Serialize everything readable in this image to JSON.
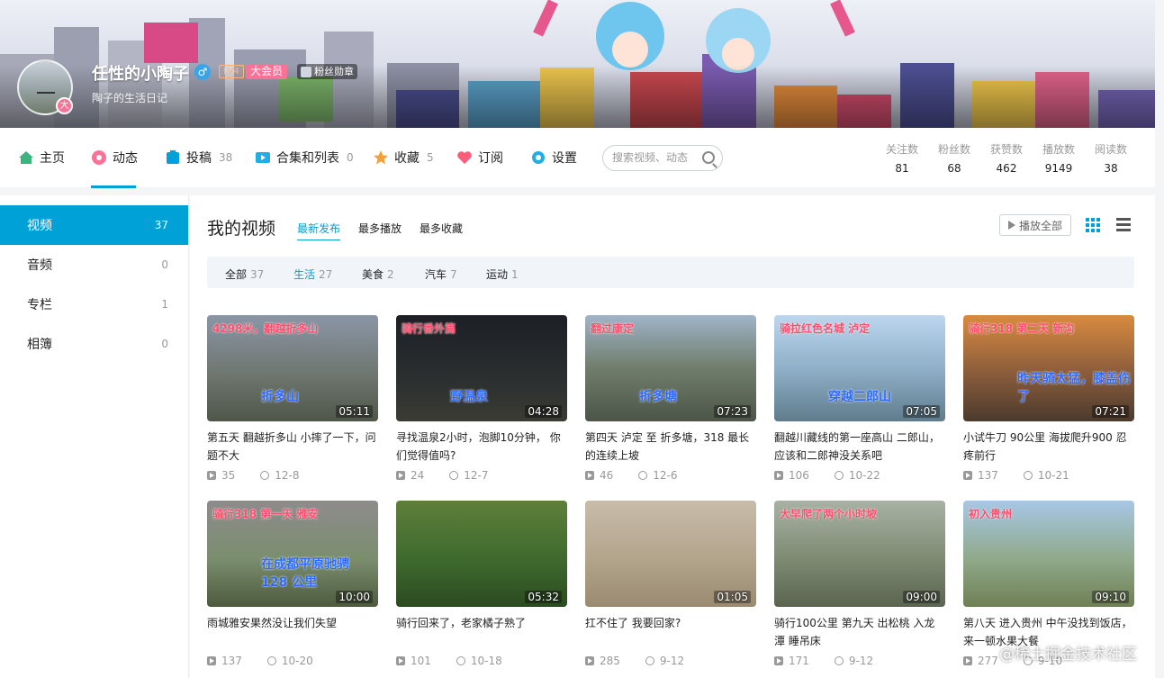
{
  "profile": {
    "name": "任性的小陶子",
    "gender_icon": "♂",
    "level": "LV4",
    "vip_label": "大会员",
    "medal_label": "粉丝勋章",
    "signature": "陶子的生活日记",
    "avatar_badge": "大"
  },
  "nav": {
    "items": [
      {
        "label": "主页",
        "count": "",
        "icon": "home-icon",
        "color": "#3fb37f"
      },
      {
        "label": "动态",
        "count": "",
        "icon": "dynamic-icon",
        "color": "#fb7299"
      },
      {
        "label": "投稿",
        "count": "38",
        "icon": "upload-icon",
        "color": "#00a1d6"
      },
      {
        "label": "合集和列表",
        "count": "0",
        "icon": "collection-icon",
        "color": "#23ade5"
      },
      {
        "label": "收藏",
        "count": "5",
        "icon": "star-icon",
        "color": "#f3a034"
      },
      {
        "label": "订阅",
        "count": "",
        "icon": "heart-icon",
        "color": "#ff5c7c"
      },
      {
        "label": "设置",
        "count": "",
        "icon": "gear-icon",
        "color": "#23ade5"
      }
    ],
    "search_placeholder": "搜索视频、动态",
    "stats": [
      {
        "label": "关注数",
        "value": "81"
      },
      {
        "label": "粉丝数",
        "value": "68"
      },
      {
        "label": "获赞数",
        "value": "462"
      },
      {
        "label": "播放数",
        "value": "9149"
      },
      {
        "label": "阅读数",
        "value": "38"
      }
    ]
  },
  "sidebar": {
    "items": [
      {
        "label": "视频",
        "count": "37"
      },
      {
        "label": "音频",
        "count": "0"
      },
      {
        "label": "专栏",
        "count": "1"
      },
      {
        "label": "相簿",
        "count": "0"
      }
    ]
  },
  "main": {
    "title": "我的视频",
    "sorts": [
      "最新发布",
      "最多播放",
      "最多收藏"
    ],
    "play_all": "播放全部",
    "filters": [
      {
        "label": "全部",
        "count": "37"
      },
      {
        "label": "生活",
        "count": "27"
      },
      {
        "label": "美食",
        "count": "2"
      },
      {
        "label": "汽车",
        "count": "7"
      },
      {
        "label": "运动",
        "count": "1"
      }
    ]
  },
  "videos": [
    {
      "title": "第五天 翻越折多山 小摔了一下，问题不大",
      "duration": "05:11",
      "plays": "35",
      "date": "12-8",
      "cap": "4298米，翻越折多山",
      "cap2": "折多山",
      "bg": "linear-gradient(180deg,#8a96a6 0%,#6f7770 55%,#4f5649 100%)"
    },
    {
      "title": "寻找温泉2小时，泡脚10分钟， 你们觉得值吗?",
      "duration": "04:28",
      "plays": "24",
      "date": "12-7",
      "cap": "骑行番外篇",
      "cap2": "野温泉",
      "bg": "linear-gradient(180deg,#1c1f24 0%,#2b2f30 60%,#3a3b33 100%)"
    },
    {
      "title": "第四天 泸定 至 折多塘，318 最长的连续上坡",
      "duration": "07:23",
      "plays": "46",
      "date": "12-6",
      "cap": "翻过康定",
      "cap2": "折多塘",
      "bg": "linear-gradient(180deg,#9fb4c8 0%,#707d6c 50%,#4c5548 100%)"
    },
    {
      "title": "翻越川藏线的第一座高山 二郎山，应该和二郎神没关系吧",
      "duration": "07:05",
      "plays": "106",
      "date": "10-22",
      "cap": "骑拉红色名城 泸定",
      "cap2": "穿越二郎山",
      "bg": "linear-gradient(180deg,#bcd6ee 0%,#8fb0c8 50%,#607c8c 100%)"
    },
    {
      "title": "小试牛刀 90公里 海拔爬升900 忍疼前行",
      "duration": "07:21",
      "plays": "137",
      "date": "10-21",
      "cap": "骑行318 第二天 新沟",
      "cap2": "昨天骑太猛，膝盖伤了",
      "bg": "linear-gradient(180deg,#d98b3f 0%,#8a5c3c 55%,#4b3a2d 100%)"
    },
    {
      "title": "雨城雅安果然没让我们失望",
      "duration": "10:00",
      "plays": "137",
      "date": "10-20",
      "cap": "骑行318 第一天 雅安",
      "cap2": "在成都平原驰骋 128 公里",
      "bg": "linear-gradient(180deg,#8f8b8c 0%,#7a8e6e 55%,#4d5a3d 100%)"
    },
    {
      "title": "骑行回来了，老家橘子熟了",
      "duration": "05:32",
      "plays": "101",
      "date": "10-18",
      "cap": "",
      "cap2": "",
      "bg": "linear-gradient(180deg,#5e7f3a 0%,#3f6a2e 55%,#2b4a20 100%)"
    },
    {
      "title": "扛不住了 我要回家?",
      "duration": "01:05",
      "plays": "285",
      "date": "9-12",
      "cap": "",
      "cap2": "",
      "bg": "linear-gradient(180deg,#c8bca9 0%,#b3a48c 55%,#9a8a72 100%)"
    },
    {
      "title": "骑行100公里 第九天 出松桃 入龙潭 睡吊床",
      "duration": "09:00",
      "plays": "171",
      "date": "9-12",
      "cap": "大早爬了两个小时坡",
      "cap2": "",
      "bg": "linear-gradient(180deg,#a8b2a4 0%,#7e8a72 55%,#5a6450 100%)"
    },
    {
      "title": "第八天 进入贵州 中午没找到饭店，来一顿水果大餐",
      "duration": "09:10",
      "plays": "277",
      "date": "9-10",
      "cap": "初入贵州",
      "cap2": "",
      "bg": "linear-gradient(180deg,#a7c7e6 0%,#8fa98a 55%,#6f7f55 100%)"
    }
  ],
  "watermark": "@稀土掘金技术社区"
}
